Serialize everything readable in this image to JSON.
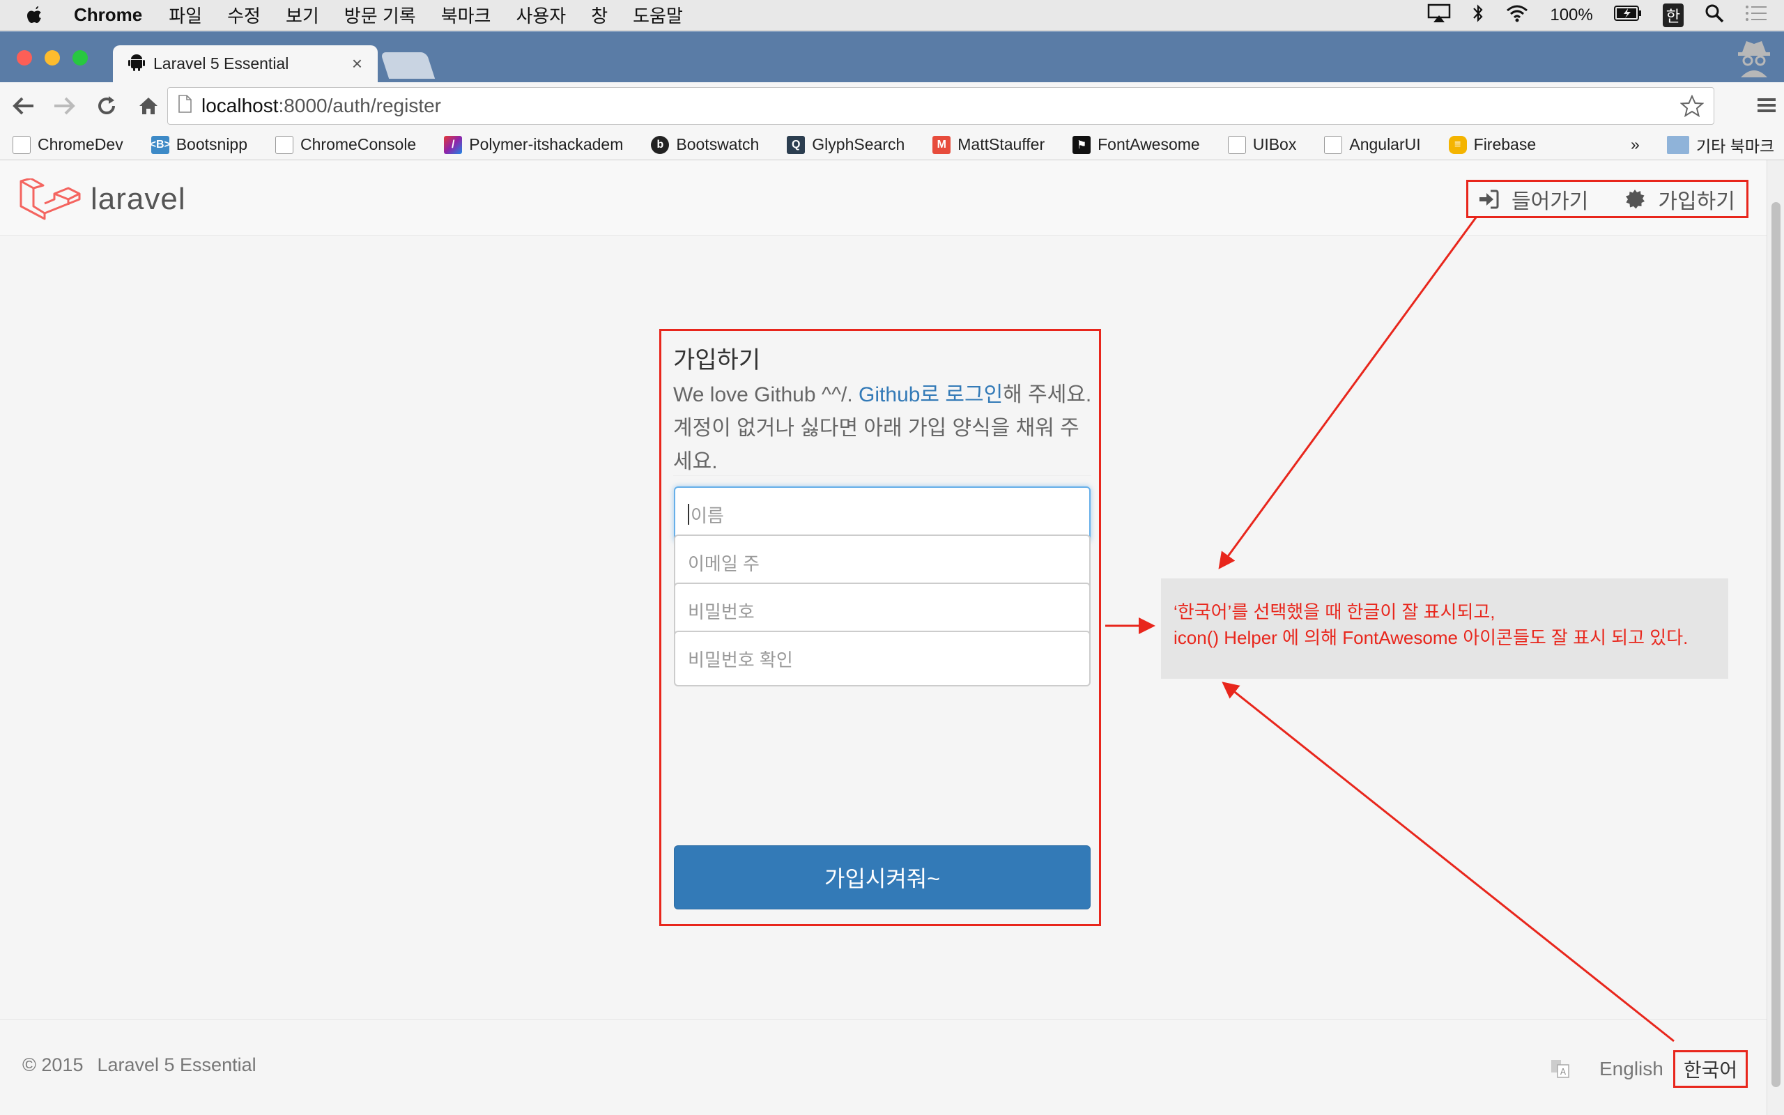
{
  "menubar": {
    "app": "Chrome",
    "items": [
      "파일",
      "수정",
      "보기",
      "방문 기록",
      "북마크",
      "사용자",
      "창",
      "도움말"
    ],
    "battery": "100%",
    "input_method": "한"
  },
  "browser": {
    "tab_title": "Laravel 5 Essential",
    "url_host": "localhost",
    "url_path": ":8000/auth/register",
    "bookmarks": [
      "ChromeDev",
      "Bootsnipp",
      "ChromeConsole",
      "Polymer-itshackadem",
      "Bootswatch",
      "GlyphSearch",
      "MattStauffer",
      "FontAwesome",
      "UIBox",
      "AngularUI",
      "Firebase"
    ],
    "bookmarks_overflow": "»",
    "other_bookmarks": "기타 북마크"
  },
  "site": {
    "brand": "laravel",
    "nav_login": "들어가기",
    "nav_register": "가입하기"
  },
  "form": {
    "title": "가입하기",
    "desc_before": "We love Github ^^/. ",
    "desc_link": "Github로 로그인",
    "desc_after": "해 주세요. 계정이 없거나 싫다면 아래 가입 양식을 채워 주세요.",
    "name_placeholder": "이름",
    "email_placeholder": "이메일 주",
    "password_placeholder": "비밀번호",
    "password_confirm_placeholder": "비밀번호 확인",
    "submit": "가입시켜줘~"
  },
  "annotation": {
    "line1": "‘한국어’를 선택했을 때 한글이 잘 표시되고,",
    "line2": "icon() Helper 에 의해 FontAwesome 아이콘들도 잘 표시 되고 있다."
  },
  "footer": {
    "copyright": "© 2015",
    "site_name": "Laravel 5 Essential",
    "lang_en": "English",
    "lang_ko": "한국어"
  },
  "colors": {
    "primary": "#337ab7",
    "annotation_red": "#e8261c",
    "tabbar": "#5a7ca6"
  }
}
